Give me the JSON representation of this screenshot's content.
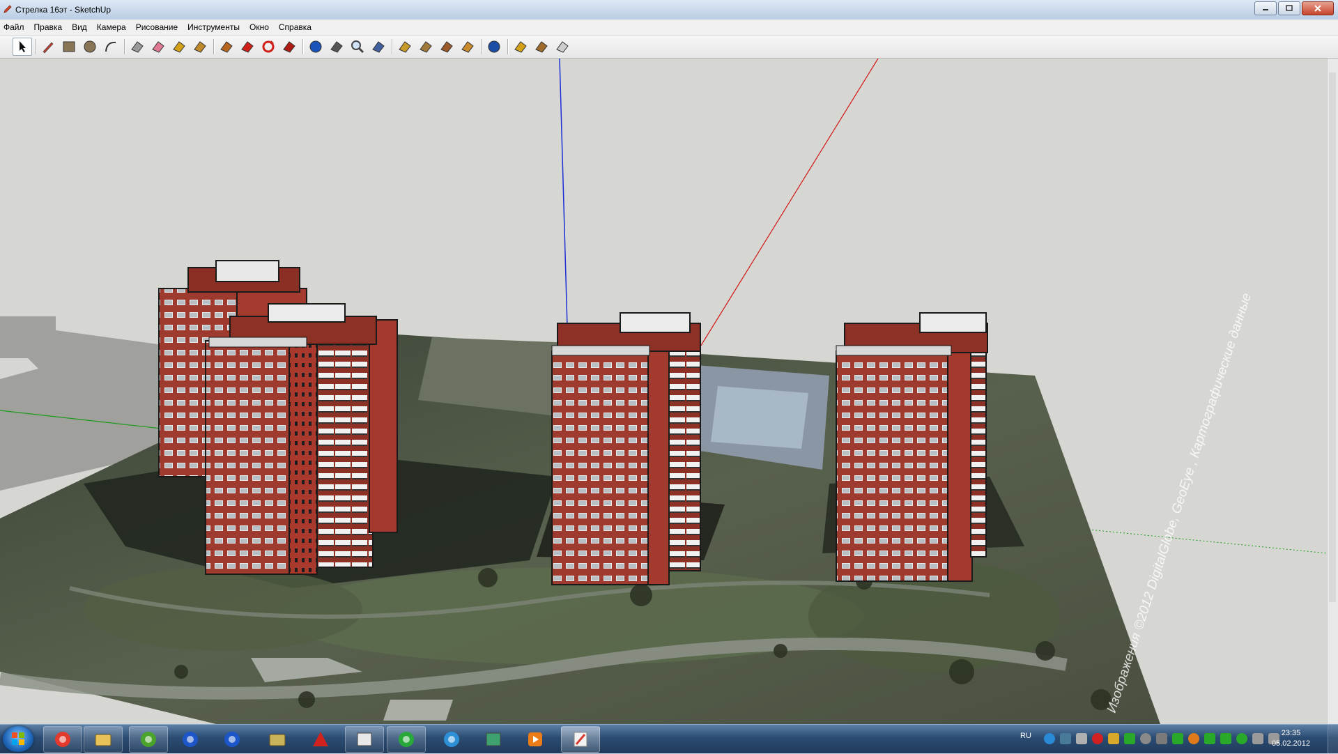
{
  "window": {
    "title": "Стрелка 16эт - SketchUp",
    "app_icon": "sketchup-pencil-icon",
    "buttons": [
      "minimize",
      "maximize",
      "close"
    ]
  },
  "menubar": {
    "items": [
      "Файл",
      "Правка",
      "Вид",
      "Камера",
      "Рисование",
      "Инструменты",
      "Окно",
      "Справка"
    ]
  },
  "toolbar": {
    "tools": [
      {
        "name": "select-icon",
        "color": "#111111"
      },
      {
        "name": "pencil-line-icon",
        "color": "#c0392b"
      },
      {
        "name": "rectangle-icon",
        "color": "#8a7456"
      },
      {
        "name": "circle-icon",
        "color": "#8a7456"
      },
      {
        "name": "arc-icon",
        "color": "#333333"
      },
      {
        "name": "make-component-icon",
        "color": "#999999"
      },
      {
        "name": "eraser-icon",
        "color": "#e07a92"
      },
      {
        "name": "tape-measure-icon",
        "color": "#d4a017"
      },
      {
        "name": "paint-bucket-icon",
        "color": "#c08a2a"
      },
      {
        "name": "push-pull-icon",
        "color": "#b5651d"
      },
      {
        "name": "move-icon",
        "color": "#d0201a"
      },
      {
        "name": "rotate-icon",
        "color": "#d0201a"
      },
      {
        "name": "offset-icon",
        "color": "#b01a14"
      },
      {
        "name": "orbit-icon",
        "color": "#1b54b8"
      },
      {
        "name": "pan-icon",
        "color": "#555555"
      },
      {
        "name": "zoom-icon",
        "color": "#444444"
      },
      {
        "name": "zoom-extents-icon",
        "color": "#3f5f9f"
      },
      {
        "name": "previous-view-icon",
        "color": "#c79a2a"
      },
      {
        "name": "next-view-icon",
        "color": "#a07a3a"
      },
      {
        "name": "position-camera-icon",
        "color": "#9b5a2a"
      },
      {
        "name": "walk-icon",
        "color": "#c88a2a"
      },
      {
        "name": "look-around-icon",
        "color": "#1d4ea5"
      },
      {
        "name": "get-models-icon",
        "color": "#d4a017"
      },
      {
        "name": "share-model-icon",
        "color": "#a06a2a"
      },
      {
        "name": "share-component-icon",
        "color": "#cccccc"
      }
    ]
  },
  "scene": {
    "sky_color": "#d6d6d2",
    "axes": {
      "blue": "#1a2fd6",
      "red": "#d21616",
      "green": "#1b9a1b"
    },
    "brick_color": "#a4392d",
    "ground_watermark": "Изображения ©2012 DigitalGlobe, GeoEye , Картографические данные"
  },
  "taskbar": {
    "apps": [
      {
        "name": "chrome-icon",
        "color": "#e23b2e"
      },
      {
        "name": "file-explorer-icon",
        "color": "#e8c35a"
      },
      {
        "name": "utorrent-icon",
        "color": "#4aa32a"
      },
      {
        "name": "blue-orb-icon",
        "color": "#1c56c9"
      },
      {
        "name": "blue-orb-2-icon",
        "color": "#1c56c9"
      },
      {
        "name": "scanner-icon",
        "color": "#c8b25a"
      },
      {
        "name": "autocad-icon",
        "color": "#d0231c"
      },
      {
        "name": "sketchup-window-icon",
        "color": "#e8e8e8"
      },
      {
        "name": "at-mail-icon",
        "color": "#29a83a"
      },
      {
        "name": "icq-four-icon",
        "color": "#2f8fd6"
      },
      {
        "name": "gem-icon",
        "color": "#3fa070"
      },
      {
        "name": "media-player-icon",
        "color": "#ec7c18"
      },
      {
        "name": "sketchup-task-icon",
        "color": "#d93b2e"
      }
    ],
    "tray": {
      "language": "RU",
      "icon_colors": [
        "#2a8ad6",
        "#4a7a9a",
        "#b0b0b0",
        "#d02020",
        "#d8a82a",
        "#2aa82a",
        "#8a8a8a",
        "#7a7a7a",
        "#2aa82a",
        "#e07a1a",
        "#2aa82a",
        "#2aa82a",
        "#2aa82a",
        "#9a9a9a",
        "#9a9a9a"
      ],
      "time": "23:35",
      "date": "05.02.2012"
    }
  }
}
